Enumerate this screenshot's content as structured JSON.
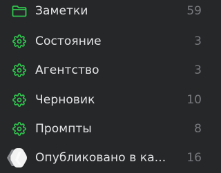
{
  "accent_color": "#30c74f",
  "rows": [
    {
      "label": "Заметки",
      "count": "59",
      "icon": "folder-icon"
    },
    {
      "label": "Состояние",
      "count": "3",
      "icon": "gear-icon"
    },
    {
      "label": "Агентство",
      "count": "3",
      "icon": "gear-icon"
    },
    {
      "label": "Черновик",
      "count": "10",
      "icon": "gear-icon"
    },
    {
      "label": "Промпты",
      "count": "8",
      "icon": "gear-icon"
    },
    {
      "label": "Опубликовано в ка...",
      "count": "16",
      "icon": "publish-logo-icon"
    }
  ]
}
